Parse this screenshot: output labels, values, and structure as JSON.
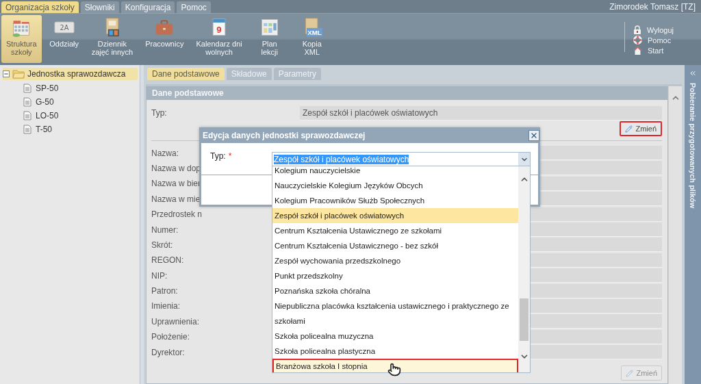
{
  "menu_tabs": [
    {
      "label": "Organizacja szkoły",
      "selected": true
    },
    {
      "label": "Słowniki",
      "selected": false
    },
    {
      "label": "Konfiguracja",
      "selected": false
    },
    {
      "label": "Pomoc",
      "selected": false
    }
  ],
  "user": "Zimorodek Tomasz [TZ]",
  "toolbar": [
    {
      "kind": "school",
      "label": "Struktura\nszkoły",
      "selected": true
    },
    {
      "kind": "board",
      "badge": "2A",
      "label": "Oddziały",
      "selected": false
    },
    {
      "kind": "journal",
      "label": "Dziennik\nzajęć innych",
      "selected": false
    },
    {
      "kind": "briefcase",
      "label": "Pracownicy",
      "selected": false
    },
    {
      "kind": "calendar",
      "badge": "9",
      "label": "Kalendarz dni\nwolnych",
      "selected": false
    },
    {
      "kind": "plan",
      "label": "Plan\nlekcji",
      "selected": false
    },
    {
      "kind": "xml",
      "badge": "XML",
      "label": "Kopia\nXML",
      "selected": false
    }
  ],
  "quick_links": [
    {
      "kind": "lock",
      "label": "Wyloguj"
    },
    {
      "kind": "lifebuoy",
      "label": "Pomoc"
    },
    {
      "kind": "home",
      "label": "Start"
    }
  ],
  "tree": {
    "label": "Jednostka sprawozdawcza",
    "expanded": true,
    "selected": true,
    "children": [
      {
        "label": "SP-50",
        "selected": false
      },
      {
        "label": "G-50",
        "selected": false
      },
      {
        "label": "LO-50",
        "selected": false
      },
      {
        "label": "T-50",
        "selected": false
      }
    ]
  },
  "tabs": [
    {
      "label": "Dane podstawowe",
      "selected": true
    },
    {
      "label": "Składowe",
      "selected": false
    },
    {
      "label": "Parametry",
      "selected": false
    }
  ],
  "panel": {
    "title": "Dane podstawowe",
    "type_label": "Typ:",
    "type_value": "Zespół szkół i placówek oświatowych",
    "change_button": {
      "label": "Zmień",
      "highlighted": true,
      "disabled": false
    },
    "fields": [
      "Nazwa:",
      "Nazwa w dop",
      "Nazwa w bier",
      "Nazwa w mie",
      "Przedrostek n",
      "Numer:",
      "Skrót:",
      "REGON:",
      "NIP:",
      "Patron:",
      "Imienia:",
      "Uprawnienia:",
      "Położenie:",
      "Dyrektor:"
    ],
    "bottom_button": {
      "label": "Zmień",
      "highlighted": false,
      "disabled": true
    }
  },
  "side_panel": {
    "title": "Pobieranie przygotowanych plików",
    "collapsed": true
  },
  "dialog": {
    "title": "Edycja danych jednostki sprawozdawczej",
    "field_label": "Typ:",
    "required_mark": "*",
    "value": "Zespół szkół i placówek oświatowych",
    "options": [
      {
        "label": "Kolegium nauczycielskie",
        "selected": false,
        "hovered": false
      },
      {
        "label": "Nauczycielskie Kolegium Języków Obcych",
        "selected": false,
        "hovered": false
      },
      {
        "label": "Kolegium Pracowników Służb Społecznych",
        "selected": false,
        "hovered": false
      },
      {
        "label": "Zespół szkół i placówek oświatowych",
        "selected": true,
        "hovered": false
      },
      {
        "label": "Centrum Kształcenia Ustawicznego ze szkołami",
        "selected": false,
        "hovered": false
      },
      {
        "label": "Centrum Kształcenia Ustawicznego - bez szkół",
        "selected": false,
        "hovered": false
      },
      {
        "label": "Zespół wychowania przedszkolnego",
        "selected": false,
        "hovered": false
      },
      {
        "label": "Punkt przedszkolny",
        "selected": false,
        "hovered": false
      },
      {
        "label": "Poznańska szkoła chóralna",
        "selected": false,
        "hovered": false
      },
      {
        "label": "Niepubliczna placówka kształcenia ustawicznego i praktycznego ze\nszkołami",
        "selected": false,
        "hovered": false
      },
      {
        "label": "Szkoła policealna muzyczna",
        "selected": false,
        "hovered": false
      },
      {
        "label": "Szkoła policealna plastyczna",
        "selected": false,
        "hovered": false
      },
      {
        "label": "Branżowa szkoła I stopnia",
        "selected": false,
        "hovered": true
      }
    ]
  }
}
